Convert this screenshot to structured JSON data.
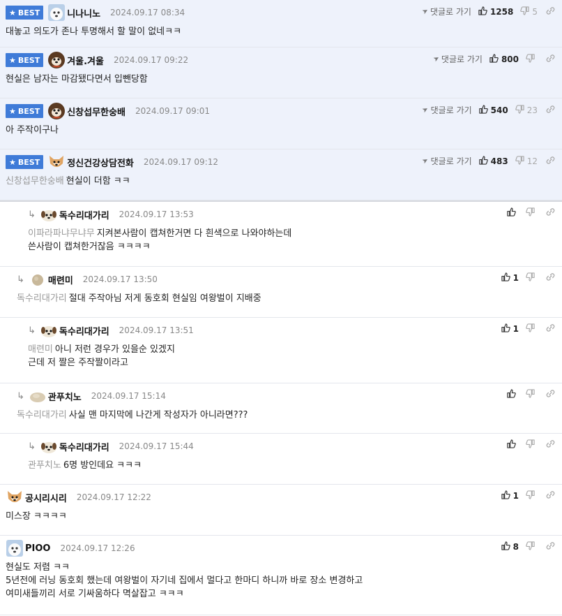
{
  "best_label": "BEST",
  "goto_label": "댓글로 가기",
  "comments": [
    {
      "best": true,
      "depth": 0,
      "avatar": "dog-white",
      "nick": "니나니노",
      "date": "2024.09.17 08:34",
      "likes": "1258",
      "dislikes": "5",
      "mention": "",
      "lines": [
        "대놓고 의도가 존나 투명해서 할 말이 없네ㅋㅋ"
      ]
    },
    {
      "best": true,
      "depth": 0,
      "avatar": "dog-dark",
      "nick": "겨울.겨울",
      "date": "2024.09.17 09:22",
      "likes": "800",
      "dislikes": "",
      "mention": "",
      "lines": [
        "현실은 남자는 마감됐다면서 입뺀당함"
      ]
    },
    {
      "best": true,
      "depth": 0,
      "avatar": "dog-dark",
      "nick": "신창섭무한숭배",
      "date": "2024.09.17 09:01",
      "likes": "540",
      "dislikes": "23",
      "mention": "",
      "lines": [
        "아 주작이구나"
      ]
    },
    {
      "best": true,
      "depth": 0,
      "avatar": "dog-shiba",
      "nick": "정신건강상담전화",
      "date": "2024.09.17 09:12",
      "likes": "483",
      "dislikes": "12",
      "mention": "신창섭무한숭배",
      "lines": [
        "현실이 더함 ㅋㅋ"
      ]
    },
    {
      "best": false,
      "depth": 2,
      "avatar": "dog-puppy",
      "nick": "독수리대가리",
      "date": "2024.09.17 13:53",
      "likes": "",
      "dislikes": "",
      "mention": "이파라파냐무냐무",
      "lines": [
        "지켜본사람이 캡쳐한거면 다 흰색으로 나와야하는데",
        "쓴사람이 캡쳐한거잖음 ㅋㅋㅋㅋ"
      ]
    },
    {
      "best": false,
      "depth": 1,
      "avatar": "ball-brown",
      "nick": "매련미",
      "date": "2024.09.17 13:50",
      "likes": "1",
      "dislikes": "",
      "mention": "독수리대가리",
      "lines": [
        "절대 주작아님 저게 동호회 현실임 여왕벌이 지배중"
      ]
    },
    {
      "best": false,
      "depth": 2,
      "avatar": "dog-puppy",
      "nick": "독수리대가리",
      "date": "2024.09.17 13:51",
      "likes": "1",
      "dislikes": "",
      "mention": "매련미",
      "lines": [
        "아니 저런 경우가 있을순 있겠지",
        "근데 저 짤은 주작짤이라고"
      ]
    },
    {
      "best": false,
      "depth": 1,
      "avatar": "ball-beige",
      "nick": "관푸치노",
      "date": "2024.09.17 15:14",
      "likes": "",
      "dislikes": "",
      "mention": "독수리대가리",
      "lines": [
        "사실 맨 마지막에 나간게 작성자가 아니라면???"
      ]
    },
    {
      "best": false,
      "depth": 2,
      "avatar": "dog-puppy",
      "nick": "독수리대가리",
      "date": "2024.09.17 15:44",
      "likes": "",
      "dislikes": "",
      "mention": "관푸치노",
      "lines": [
        "6명 방인데요 ㅋㅋㅋ"
      ]
    },
    {
      "best": false,
      "depth": 0,
      "avatar": "dog-shiba",
      "nick": "공시리시리",
      "date": "2024.09.17 12:22",
      "likes": "1",
      "dislikes": "",
      "mention": "",
      "lines": [
        "미스장 ㅋㅋㅋㅋ"
      ]
    },
    {
      "best": false,
      "depth": 0,
      "avatar": "dog-white",
      "nick": "PIOO",
      "date": "2024.09.17 12:26",
      "likes": "8",
      "dislikes": "",
      "mention": "",
      "lines": [
        "현실도 저렴 ㅋㅋ",
        "5년전에 러닝 동호회 했는데 여왕벌이 자기네 집에서 멀다고 한마디 하니까 바로 장소 변경하고",
        "여미새들끼리 서로 기싸움하다 멱살잡고 ㅋㅋㅋ"
      ]
    }
  ]
}
